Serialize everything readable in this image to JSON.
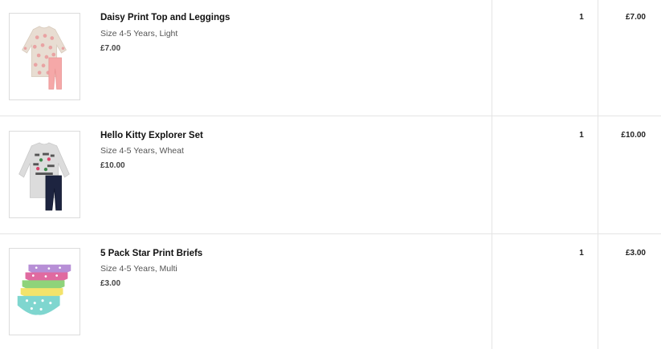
{
  "basket": {
    "items": [
      {
        "name": "Daisy Print Top and Leggings",
        "variant": "Size 4-5 Years, Light",
        "price": "£7.00",
        "quantity": "1",
        "total": "£7.00",
        "image": "daisy-print-top-and-leggings-image"
      },
      {
        "name": "Hello Kitty Explorer Set",
        "variant": "Size 4-5 Years, Wheat",
        "price": "£10.00",
        "quantity": "1",
        "total": "£10.00",
        "image": "hello-kitty-explorer-set-image"
      },
      {
        "name": "5 Pack Star Print Briefs",
        "variant": "Size 4-5 Years, Multi",
        "price": "£3.00",
        "quantity": "1",
        "total": "£3.00",
        "image": "star-print-briefs-image"
      }
    ]
  },
  "colors": {
    "border": "#e4e4e4",
    "text": "#111111",
    "muted": "#555555"
  }
}
